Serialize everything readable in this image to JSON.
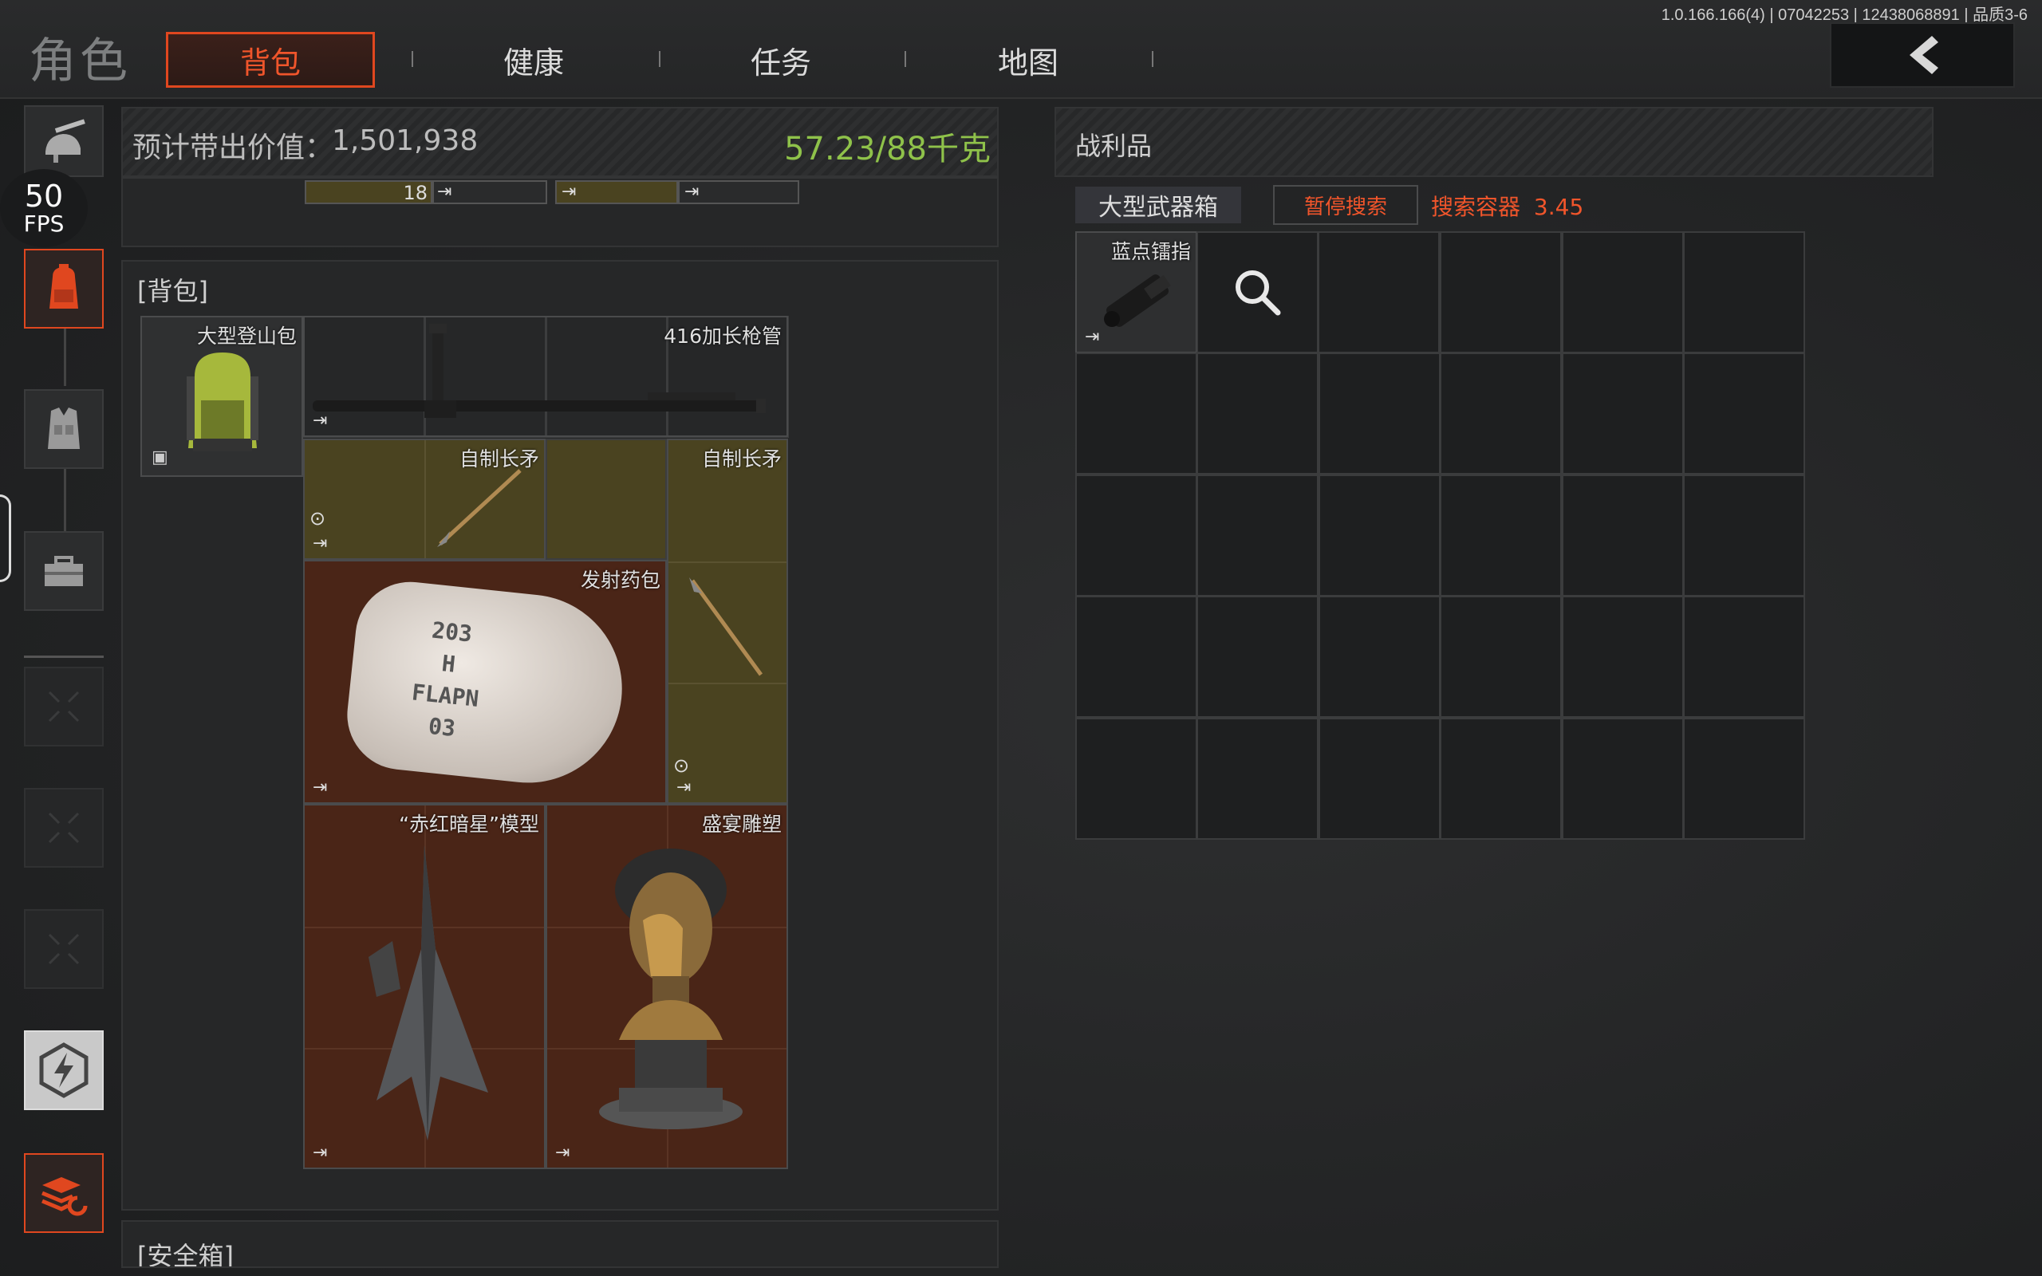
{
  "version": "1.0.166.166(4) | 07042253 | 12438068891 | 品质3-6",
  "header": {
    "title": "角色",
    "tabs": [
      {
        "label": "背包",
        "active": true
      },
      {
        "label": "健康",
        "active": false
      },
      {
        "label": "任务",
        "active": false
      },
      {
        "label": "地图",
        "active": false
      }
    ],
    "back_icon": "chevron-left-icon"
  },
  "fps": {
    "value": "50",
    "label": "FPS"
  },
  "sidebar": {
    "items": [
      {
        "icon": "helmet-gun-icon",
        "state": "normal"
      },
      {
        "icon": "backpack-icon",
        "state": "active"
      },
      {
        "icon": "vest-icon",
        "state": "normal"
      },
      {
        "icon": "toolbox-icon",
        "state": "normal"
      },
      {
        "icon": "empty-slot-icon",
        "state": "empty"
      },
      {
        "icon": "empty-slot-icon",
        "state": "empty"
      },
      {
        "icon": "empty-slot-icon",
        "state": "empty"
      },
      {
        "icon": "lightning-gear-icon",
        "state": "normal"
      },
      {
        "icon": "layers-refresh-icon",
        "state": "active"
      }
    ]
  },
  "inventory": {
    "value_label": "预计带出价值：",
    "value": "1,501,938",
    "weight": "57.23/88千克",
    "top_strip_count": "18",
    "backpack_section_label": "[背包]",
    "backpack_item_name": "大型登山包",
    "items": [
      {
        "name": "416加长枪管",
        "color": "gray"
      },
      {
        "name": "自制长矛",
        "color": "gold"
      },
      {
        "name": "自制长矛",
        "color": "gold"
      },
      {
        "name": "发射药包",
        "color": "rust"
      },
      {
        "name": "“赤红暗星”模型",
        "color": "rust"
      },
      {
        "name": "盛宴雕塑",
        "color": "rust"
      }
    ],
    "powder_bag_text": [
      "203",
      "H",
      "FLAPN 03"
    ],
    "safe_box_label": "[安全箱]"
  },
  "loot": {
    "title": "战利品",
    "container_name": "大型武器箱",
    "pause_button": "暂停搜索",
    "search_label": "搜索容器",
    "search_time": "3.45",
    "found_item": "蓝点镭指",
    "search_icon": "magnifier-icon",
    "grid_cols": 6,
    "grid_rows": 5
  },
  "colors": {
    "accent": "#e0471f",
    "weight_green": "#8fc24a",
    "gold_slot": "#4a4320",
    "rust_slot": "#4a2517"
  }
}
